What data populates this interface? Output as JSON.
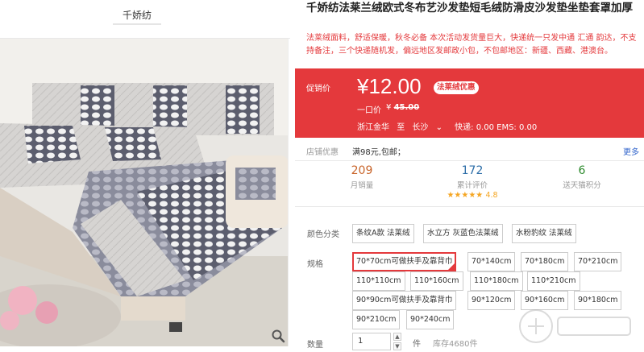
{
  "gallery": {
    "brand": "千娇纺"
  },
  "product": {
    "title": "千娇纺法莱兰绒欧式冬布艺沙发垫短毛绒防滑皮沙发垫坐垫套罩加厚",
    "subtitle": "法莱绒面料，舒适保暖，秋冬必备 本次活动发货量巨大，快递统一只发中通 汇通 韵达，不支持备注，三个快递随机发，偏远地区发邮政小包，不包邮地区：新疆、西藏、港澳台。"
  },
  "promo": {
    "label": "促销价",
    "price": "¥12.00",
    "tag": "法莱绒优惠",
    "orig_label": "一口价",
    "orig_currency": "¥",
    "orig_value": "45.00",
    "ship_from": "浙江金华",
    "ship_to_word": "至",
    "ship_to": "长沙",
    "ship_to_arrow": "⌄",
    "shipping": "快递: 0.00 EMS: 0.00"
  },
  "coupon": {
    "label": "店铺优惠",
    "text": "满98元,包邮；",
    "more": "更多"
  },
  "stats": {
    "sales_num": "209",
    "sales_label": "月销量",
    "reviews_num": "172",
    "reviews_label": "累计评价",
    "rating_stars": "★★★★★",
    "rating_score": "4.8",
    "points_num": "6",
    "points_label": "送天猫积分"
  },
  "options": {
    "color_label": "颜色分类",
    "colors": [
      "条纹A款 法莱绒",
      "水立方 灰蓝色法莱绒",
      "水粉豹纹 法莱绒"
    ],
    "size_label": "规格",
    "sizes": [
      "70*70cm可做扶手及靠背巾",
      "70*140cm",
      "70*180cm",
      "70*210cm",
      "110*110cm",
      "110*160cm",
      "110*180cm",
      "110*210cm",
      "90*90cm可做扶手及靠背巾",
      "90*120cm",
      "90*160cm",
      "90*180cm",
      "90*210cm",
      "90*240cm"
    ],
    "qty_label": "数量",
    "qty_value": "1",
    "qty_unit": "件",
    "stock": "库存4680件"
  },
  "colors": {
    "accent": "#e4393c",
    "link": "#3366cc"
  }
}
